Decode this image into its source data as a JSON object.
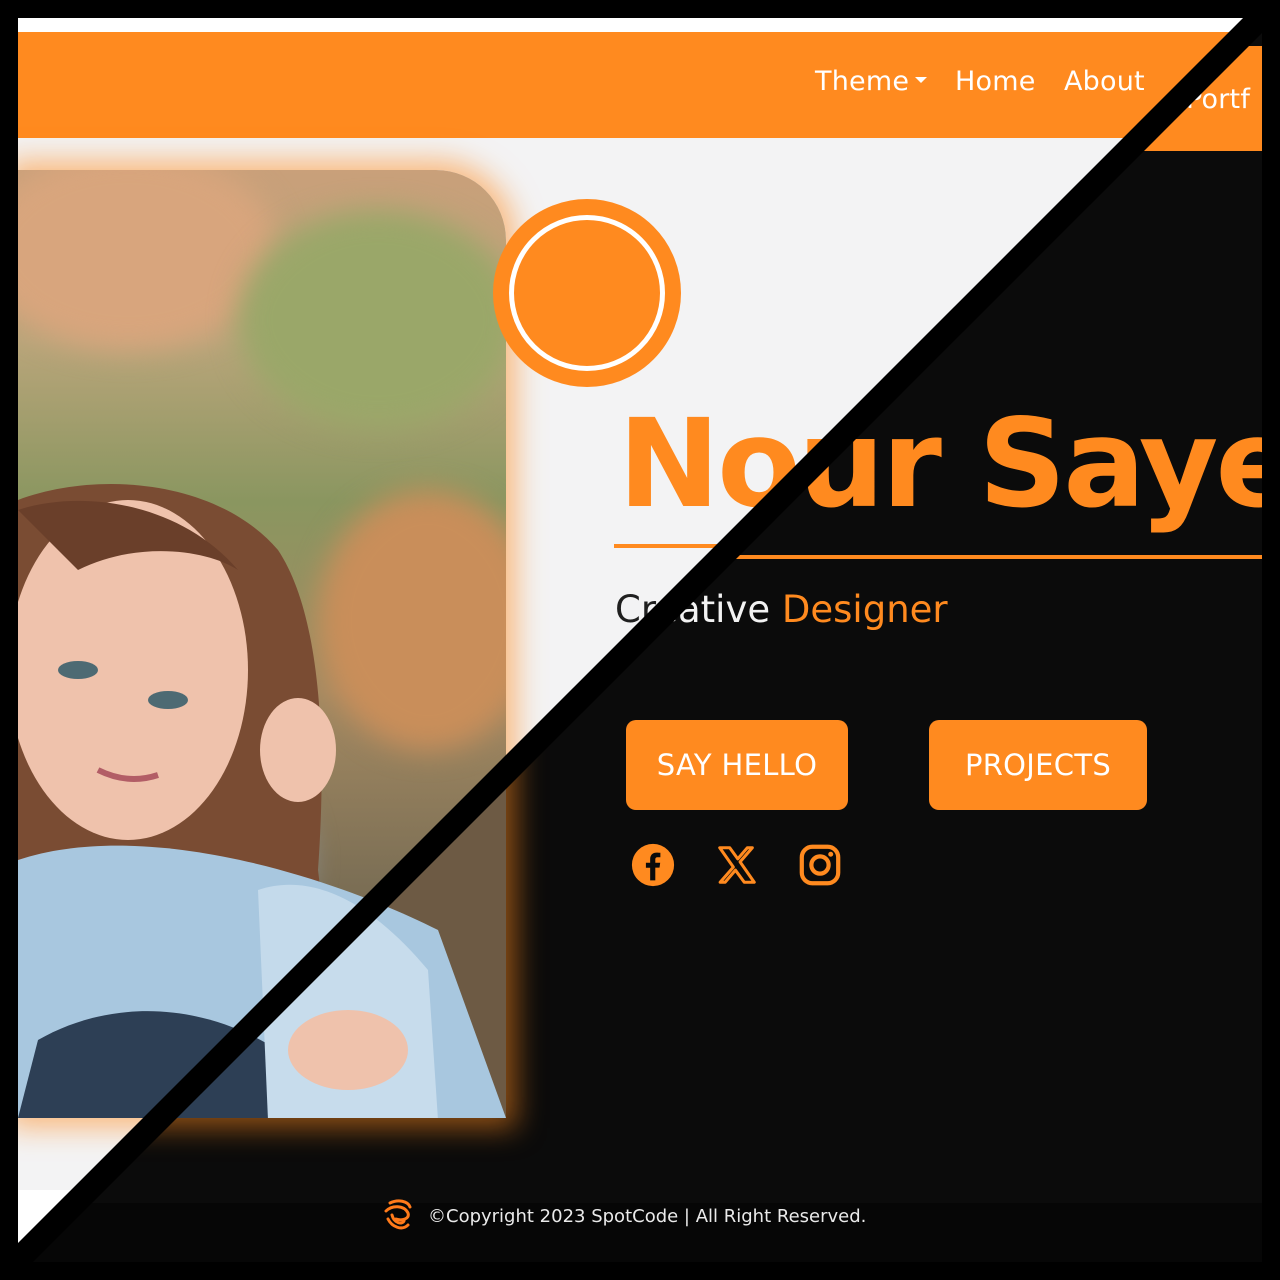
{
  "nav": {
    "theme_label": "Theme",
    "home_label": "Home",
    "about_label": "About",
    "portfolio_label": "Portf"
  },
  "hero": {
    "name": "Nour Saye",
    "subtitle_word1": "Creative",
    "subtitle_word2": "Designer",
    "say_hello_label": "SAY HELLO",
    "projects_label": "PROJECTS"
  },
  "social": {
    "icons": [
      "facebook-icon",
      "x-icon",
      "instagram-icon"
    ]
  },
  "footer": {
    "copyright": "©Copyright 2023 SpotCode | All Right Reserved."
  },
  "colors": {
    "accent": "#ff8a1f",
    "light_bg": "#f3f3f4",
    "dark_bg": "#0b0b0b",
    "footer_bg": "#060606"
  }
}
